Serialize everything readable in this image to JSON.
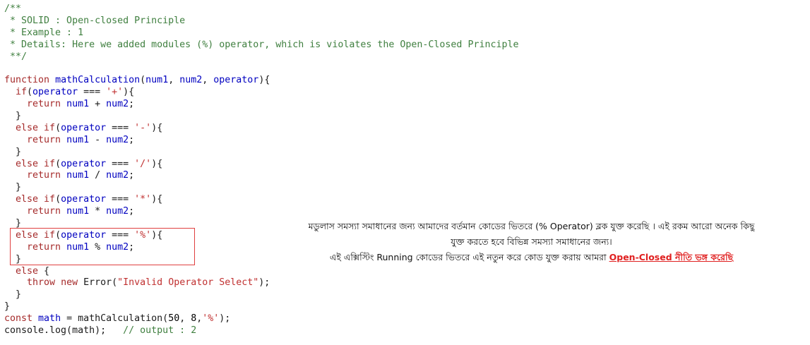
{
  "code": {
    "lines": [
      {
        "parts": [
          {
            "t": "/**",
            "c": "comment"
          }
        ]
      },
      {
        "parts": [
          {
            "t": " * SOLID : Open-closed Principle",
            "c": "comment"
          }
        ]
      },
      {
        "parts": [
          {
            "t": " * Example : 1",
            "c": "comment"
          }
        ]
      },
      {
        "parts": [
          {
            "t": " * Details: Here we added modules (%) operator, which is violates the Open-Closed Principle",
            "c": "comment"
          }
        ]
      },
      {
        "parts": [
          {
            "t": " **/",
            "c": "comment"
          }
        ]
      },
      {
        "parts": [
          {
            "t": "",
            "c": "plain"
          }
        ]
      },
      {
        "parts": [
          {
            "t": "function ",
            "c": "kw"
          },
          {
            "t": "mathCalculation",
            "c": "fn"
          },
          {
            "t": "(",
            "c": "plain"
          },
          {
            "t": "num1",
            "c": "fn"
          },
          {
            "t": ", ",
            "c": "plain"
          },
          {
            "t": "num2",
            "c": "fn"
          },
          {
            "t": ", ",
            "c": "plain"
          },
          {
            "t": "operator",
            "c": "fn"
          },
          {
            "t": "){",
            "c": "plain"
          }
        ]
      },
      {
        "parts": [
          {
            "t": "  ",
            "c": "plain"
          },
          {
            "t": "if",
            "c": "kw"
          },
          {
            "t": "(",
            "c": "plain"
          },
          {
            "t": "operator",
            "c": "fn"
          },
          {
            "t": " === ",
            "c": "plain"
          },
          {
            "t": "'+'",
            "c": "str"
          },
          {
            "t": "){",
            "c": "plain"
          }
        ]
      },
      {
        "parts": [
          {
            "t": "    ",
            "c": "plain"
          },
          {
            "t": "return ",
            "c": "kw"
          },
          {
            "t": "num1",
            "c": "fn"
          },
          {
            "t": " + ",
            "c": "plain"
          },
          {
            "t": "num2",
            "c": "fn"
          },
          {
            "t": ";",
            "c": "plain"
          }
        ]
      },
      {
        "parts": [
          {
            "t": "  }",
            "c": "plain"
          }
        ]
      },
      {
        "parts": [
          {
            "t": "  ",
            "c": "plain"
          },
          {
            "t": "else if",
            "c": "kw"
          },
          {
            "t": "(",
            "c": "plain"
          },
          {
            "t": "operator",
            "c": "fn"
          },
          {
            "t": " === ",
            "c": "plain"
          },
          {
            "t": "'-'",
            "c": "str"
          },
          {
            "t": "){",
            "c": "plain"
          }
        ]
      },
      {
        "parts": [
          {
            "t": "    ",
            "c": "plain"
          },
          {
            "t": "return ",
            "c": "kw"
          },
          {
            "t": "num1",
            "c": "fn"
          },
          {
            "t": " - ",
            "c": "plain"
          },
          {
            "t": "num2",
            "c": "fn"
          },
          {
            "t": ";",
            "c": "plain"
          }
        ]
      },
      {
        "parts": [
          {
            "t": "  }",
            "c": "plain"
          }
        ]
      },
      {
        "parts": [
          {
            "t": "  ",
            "c": "plain"
          },
          {
            "t": "else if",
            "c": "kw"
          },
          {
            "t": "(",
            "c": "plain"
          },
          {
            "t": "operator",
            "c": "fn"
          },
          {
            "t": " === ",
            "c": "plain"
          },
          {
            "t": "'/'",
            "c": "str"
          },
          {
            "t": "){",
            "c": "plain"
          }
        ]
      },
      {
        "parts": [
          {
            "t": "    ",
            "c": "plain"
          },
          {
            "t": "return ",
            "c": "kw"
          },
          {
            "t": "num1",
            "c": "fn"
          },
          {
            "t": " / ",
            "c": "plain"
          },
          {
            "t": "num2",
            "c": "fn"
          },
          {
            "t": ";",
            "c": "plain"
          }
        ]
      },
      {
        "parts": [
          {
            "t": "  }",
            "c": "plain"
          }
        ]
      },
      {
        "parts": [
          {
            "t": "  ",
            "c": "plain"
          },
          {
            "t": "else if",
            "c": "kw"
          },
          {
            "t": "(",
            "c": "plain"
          },
          {
            "t": "operator",
            "c": "fn"
          },
          {
            "t": " === ",
            "c": "plain"
          },
          {
            "t": "'*'",
            "c": "str"
          },
          {
            "t": "){",
            "c": "plain"
          }
        ]
      },
      {
        "parts": [
          {
            "t": "    ",
            "c": "plain"
          },
          {
            "t": "return ",
            "c": "kw"
          },
          {
            "t": "num1",
            "c": "fn"
          },
          {
            "t": " * ",
            "c": "plain"
          },
          {
            "t": "num2",
            "c": "fn"
          },
          {
            "t": ";",
            "c": "plain"
          }
        ]
      },
      {
        "parts": [
          {
            "t": "  }",
            "c": "plain"
          }
        ]
      },
      {
        "parts": [
          {
            "t": "  ",
            "c": "plain"
          },
          {
            "t": "else if",
            "c": "kw"
          },
          {
            "t": "(",
            "c": "plain"
          },
          {
            "t": "operator",
            "c": "fn"
          },
          {
            "t": " === ",
            "c": "plain"
          },
          {
            "t": "'%'",
            "c": "str"
          },
          {
            "t": "){",
            "c": "plain"
          }
        ]
      },
      {
        "parts": [
          {
            "t": "    ",
            "c": "plain"
          },
          {
            "t": "return ",
            "c": "kw"
          },
          {
            "t": "num1",
            "c": "fn"
          },
          {
            "t": " % ",
            "c": "plain"
          },
          {
            "t": "num2",
            "c": "fn"
          },
          {
            "t": ";",
            "c": "plain"
          }
        ]
      },
      {
        "parts": [
          {
            "t": "  }",
            "c": "plain"
          }
        ]
      },
      {
        "parts": [
          {
            "t": "  ",
            "c": "plain"
          },
          {
            "t": "else ",
            "c": "kw"
          },
          {
            "t": "{",
            "c": "plain"
          }
        ]
      },
      {
        "parts": [
          {
            "t": "    ",
            "c": "plain"
          },
          {
            "t": "throw new ",
            "c": "kw"
          },
          {
            "t": "Error(",
            "c": "plain"
          },
          {
            "t": "\"Invalid Operator Select\"",
            "c": "str"
          },
          {
            "t": ");",
            "c": "plain"
          }
        ]
      },
      {
        "parts": [
          {
            "t": "  }",
            "c": "plain"
          }
        ]
      },
      {
        "parts": [
          {
            "t": "}",
            "c": "plain"
          }
        ]
      },
      {
        "parts": [
          {
            "t": "const ",
            "c": "kw"
          },
          {
            "t": "math",
            "c": "fn"
          },
          {
            "t": " = mathCalculation(",
            "c": "plain"
          },
          {
            "t": "50",
            "c": "num"
          },
          {
            "t": ", ",
            "c": "plain"
          },
          {
            "t": "8",
            "c": "num"
          },
          {
            "t": ",",
            "c": "plain"
          },
          {
            "t": "'%'",
            "c": "str"
          },
          {
            "t": ");",
            "c": "plain"
          }
        ]
      },
      {
        "parts": [
          {
            "t": "console.log(math);   ",
            "c": "plain"
          },
          {
            "t": "// output : 2",
            "c": "comment"
          }
        ]
      }
    ]
  },
  "note": {
    "line1": "মডুলাস সমস্যা সমাধানের জন্য আমাদের বর্তমান কোডের ভিতরে (% Operator) ব্লক যুক্ত করেছি । এই রকম আরো অনেক কিছু",
    "line2": "যুক্ত করতে হবে বিভিন্ন সমস্যা সমাধানের জন্য।",
    "line3_prefix": "এই এক্সিস্টিং Running কোডের ভিতরে এই নতুন করে কোড যুক্ত করায় আমরা ",
    "line3_emph": "Open-Closed নীতি ভঙ্গ করেছি"
  },
  "colors": {
    "comment": "#3f7f3f",
    "keyword": "#a52a2a",
    "identifier": "#0000c0",
    "string": "#c03030",
    "highlight_box": "#e04040",
    "emphasis": "#e02020"
  }
}
